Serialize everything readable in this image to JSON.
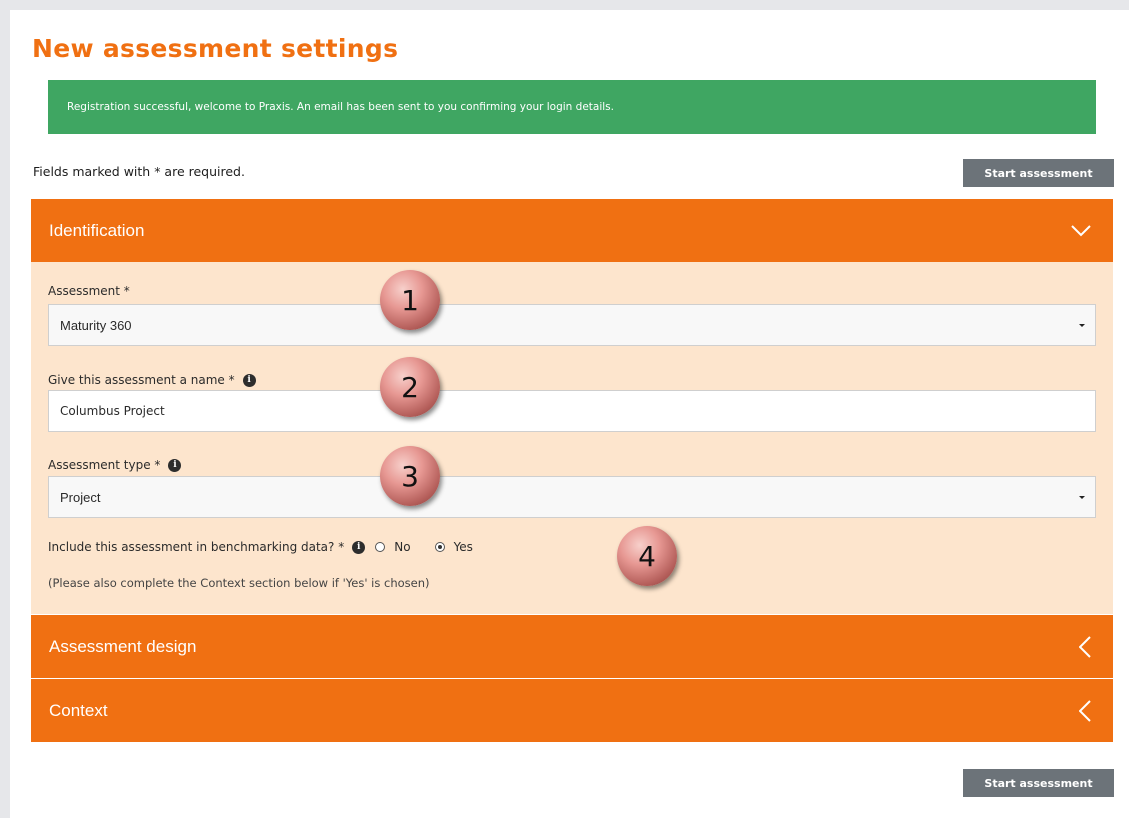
{
  "page": {
    "title": "New assessment settings",
    "alert": "Registration successful, welcome to Praxis. An email has been sent to you confirming your login details.",
    "required_note": "Fields marked with * are required.",
    "start_button": "Start assessment"
  },
  "sections": {
    "identification": "Identification",
    "design": "Assessment design",
    "context": "Context"
  },
  "form": {
    "assessment_label": "Assessment *",
    "assessment_value": "Maturity 360",
    "name_label": "Give this assessment a name *",
    "name_value": "Columbus Project",
    "type_label": "Assessment type *",
    "type_value": "Project",
    "benchmark_label": "Include this assessment in benchmarking data? *",
    "benchmark_options": [
      "No",
      "Yes"
    ],
    "benchmark_selected": "Yes",
    "benchmark_note": "(Please also complete the Context section below if 'Yes' is chosen)"
  },
  "callouts": [
    "1",
    "2",
    "3",
    "4"
  ],
  "colors": {
    "brand_orange": "#f07012",
    "panel_bg": "#fde5cd",
    "alert_green": "#3fa662",
    "button_gray": "#6c7379"
  },
  "icons": {
    "info": "info-icon",
    "chevron_down": "chevron-down-icon",
    "chevron_left": "chevron-left-icon"
  }
}
